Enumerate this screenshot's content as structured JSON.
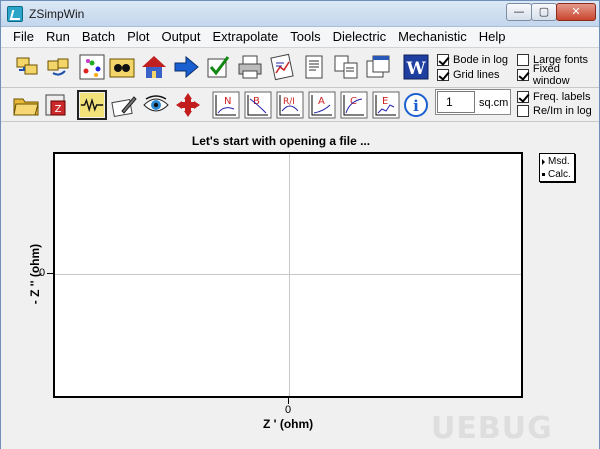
{
  "window": {
    "title": "ZSimpWin"
  },
  "menu": [
    "File",
    "Run",
    "Batch",
    "Plot",
    "Output",
    "Extrapolate",
    "Tools",
    "Dielectric",
    "Mechanistic",
    "Help"
  ],
  "options": {
    "bode_in_log": {
      "label": "Bode in log",
      "checked": true
    },
    "grid_lines": {
      "label": "Grid lines",
      "checked": true
    },
    "large_fonts": {
      "label": "Large fonts",
      "checked": false
    },
    "fixed_window": {
      "label": "Fixed window",
      "checked": true
    },
    "freq_labels": {
      "label": "Freq. labels",
      "checked": true
    },
    "re_im_in_log": {
      "label": "Re/Im in log",
      "checked": false
    }
  },
  "area": {
    "value": "1",
    "unit": "sq.cm"
  },
  "toolbar1_icons": [
    "open-files-icon",
    "copy-files-icon",
    "model-icon",
    "batch-icon",
    "house-icon",
    "arrow-right-icon",
    "check-edit-icon",
    "print-icon",
    "chart-report-icon",
    "page-icon",
    "pages-icon",
    "window-icon",
    "image-icon",
    "word-icon"
  ],
  "toolbar2_icons": [
    "open-folder-icon",
    "compress-icon",
    "circuit-icon",
    "edit-icon",
    "eye-icon",
    "move-arrows-icon",
    "plot-n-icon",
    "plot-b-icon",
    "plot-r-icon",
    "plot-a-icon",
    "plot-c-icon",
    "plot-e-icon",
    "info-icon"
  ],
  "plot": {
    "message": "Let's start with opening a file ...",
    "x_label": "Z '  (ohm)",
    "y_label": "- Z ''  (ohm)",
    "x_tick": "0",
    "y_tick": "0",
    "legend": [
      "Msd.",
      "Calc."
    ]
  },
  "chart_data": {
    "type": "scatter",
    "title": "Let's start with opening a file ...",
    "xlabel": "Z '  (ohm)",
    "ylabel": "- Z ''  (ohm)",
    "x_ticks": [
      "0"
    ],
    "y_ticks": [
      "0"
    ],
    "series": [
      {
        "name": "Msd.",
        "x": [],
        "y": []
      },
      {
        "name": "Calc.",
        "x": [],
        "y": []
      }
    ],
    "grid": true,
    "legend_position": "top-right"
  },
  "watermark": "UEBUG"
}
